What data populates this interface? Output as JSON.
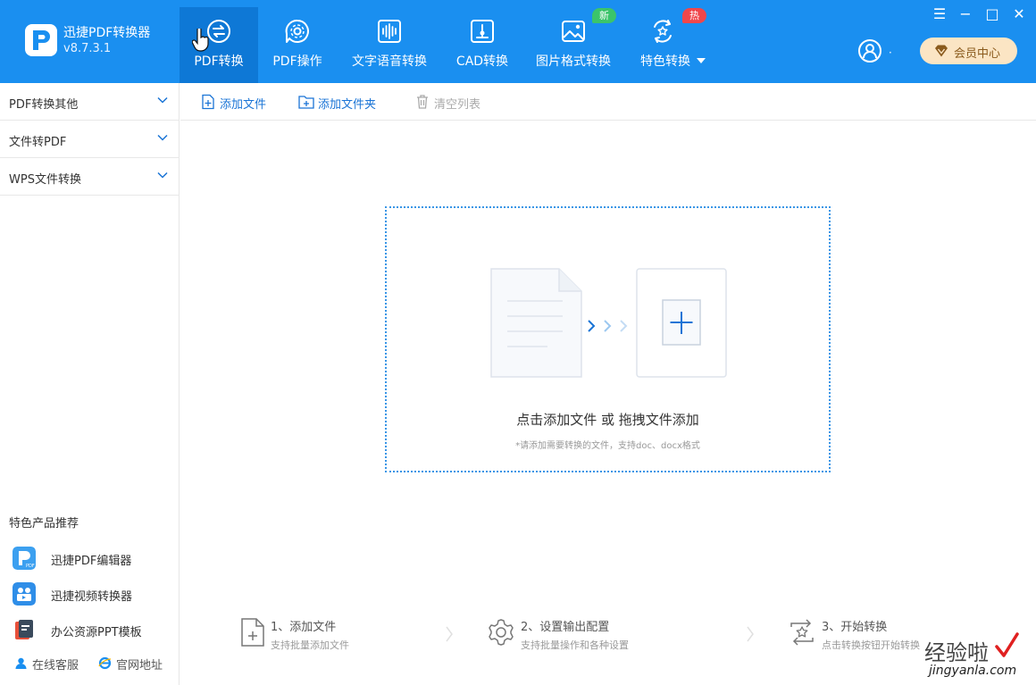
{
  "app": {
    "name": "迅捷PDF转换器",
    "version": "v8.7.3.1"
  },
  "nav": {
    "tabs": [
      {
        "label": "PDF转换",
        "icon": "convert-icon",
        "active": true
      },
      {
        "label": "PDF操作",
        "icon": "gear-bubble-icon"
      },
      {
        "label": "文字语音转换",
        "icon": "audio-wave-icon"
      },
      {
        "label": "CAD转换",
        "icon": "cad-icon"
      },
      {
        "label": "图片格式转换",
        "icon": "image-icon",
        "badge": "新"
      },
      {
        "label": "特色转换",
        "icon": "star-refresh-icon",
        "badge": "热"
      }
    ]
  },
  "window": {
    "menu": "☰",
    "minimize": "−",
    "maximize": "□",
    "close": "✕"
  },
  "user": {
    "dot": "·",
    "vip_label": "会员中心"
  },
  "sidebar": {
    "items": [
      {
        "label": "PDF转换其他"
      },
      {
        "label": "文件转PDF"
      },
      {
        "label": "WPS文件转换"
      }
    ],
    "recommend_title": "特色产品推荐",
    "recommend": [
      {
        "label": "迅捷PDF编辑器",
        "icon": "pdf-editor-icon"
      },
      {
        "label": "迅捷视频转换器",
        "icon": "video-converter-icon"
      },
      {
        "label": "办公资源PPT模板",
        "icon": "ppt-template-icon"
      }
    ],
    "links": [
      {
        "label": "在线客服",
        "icon": "user-service-icon"
      },
      {
        "label": "官网地址",
        "icon": "ie-icon"
      }
    ]
  },
  "toolbar": {
    "add_file": "添加文件",
    "add_folder": "添加文件夹",
    "clear_list": "清空列表"
  },
  "dropzone": {
    "main_text": "点击添加文件 或 拖拽文件添加",
    "hint": "*请添加需要转换的文件，支持doc、docx格式"
  },
  "steps": [
    {
      "title": "1、添加文件",
      "sub": "支持批量添加文件"
    },
    {
      "title": "2、设置输出配置",
      "sub": "支持批量操作和各种设置"
    },
    {
      "title": "3、开始转换",
      "sub": "点击转换按钮开始转换"
    }
  ],
  "colors": {
    "header": "#1a8ff0",
    "active_tab": "#0e78d6",
    "accent": "#1a74d6",
    "vip_bg": "#fbe5c4"
  },
  "watermark": {
    "main": "经验啦",
    "url": "jingyanla.com"
  }
}
